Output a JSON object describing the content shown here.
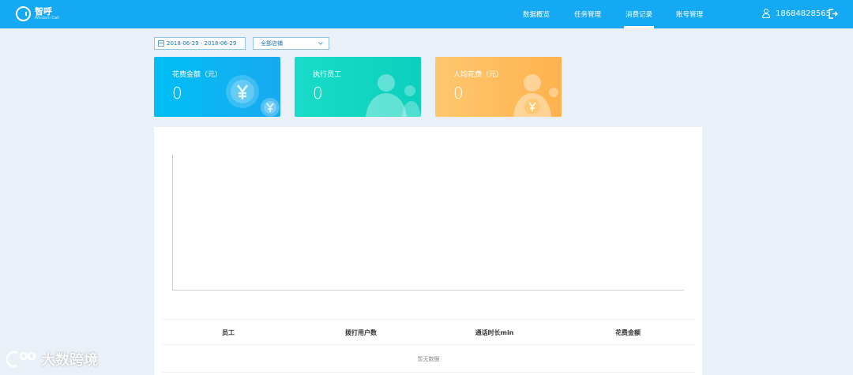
{
  "app": {
    "brand": "智呼",
    "brand_sub": "Wisdom Call"
  },
  "nav": [
    {
      "label": "数据概览",
      "active": false
    },
    {
      "label": "任务管理",
      "active": false
    },
    {
      "label": "消费记录",
      "active": true
    },
    {
      "label": "账号管理",
      "active": false
    }
  ],
  "user": {
    "phone": "18684828565"
  },
  "filters": {
    "date_range": "2018-06-29 - 2018-06-29",
    "store": "全部店铺"
  },
  "cards": [
    {
      "label": "花费金额（元）",
      "value": "0",
      "color": "#0fb5f3"
    },
    {
      "label": "执行员工",
      "value": "0",
      "color": "#12d6c2"
    },
    {
      "label": "人均花费（元）",
      "value": "0",
      "color": "#ffbb5a"
    }
  ],
  "table": {
    "columns": [
      "员工",
      "拨打用户数",
      "通话时长min",
      "花费金额"
    ],
    "empty_text": "暂无数据"
  },
  "watermark": "大数跨境",
  "colors": {
    "topbar": "#14a9f2",
    "background": "#e9f0f7"
  }
}
